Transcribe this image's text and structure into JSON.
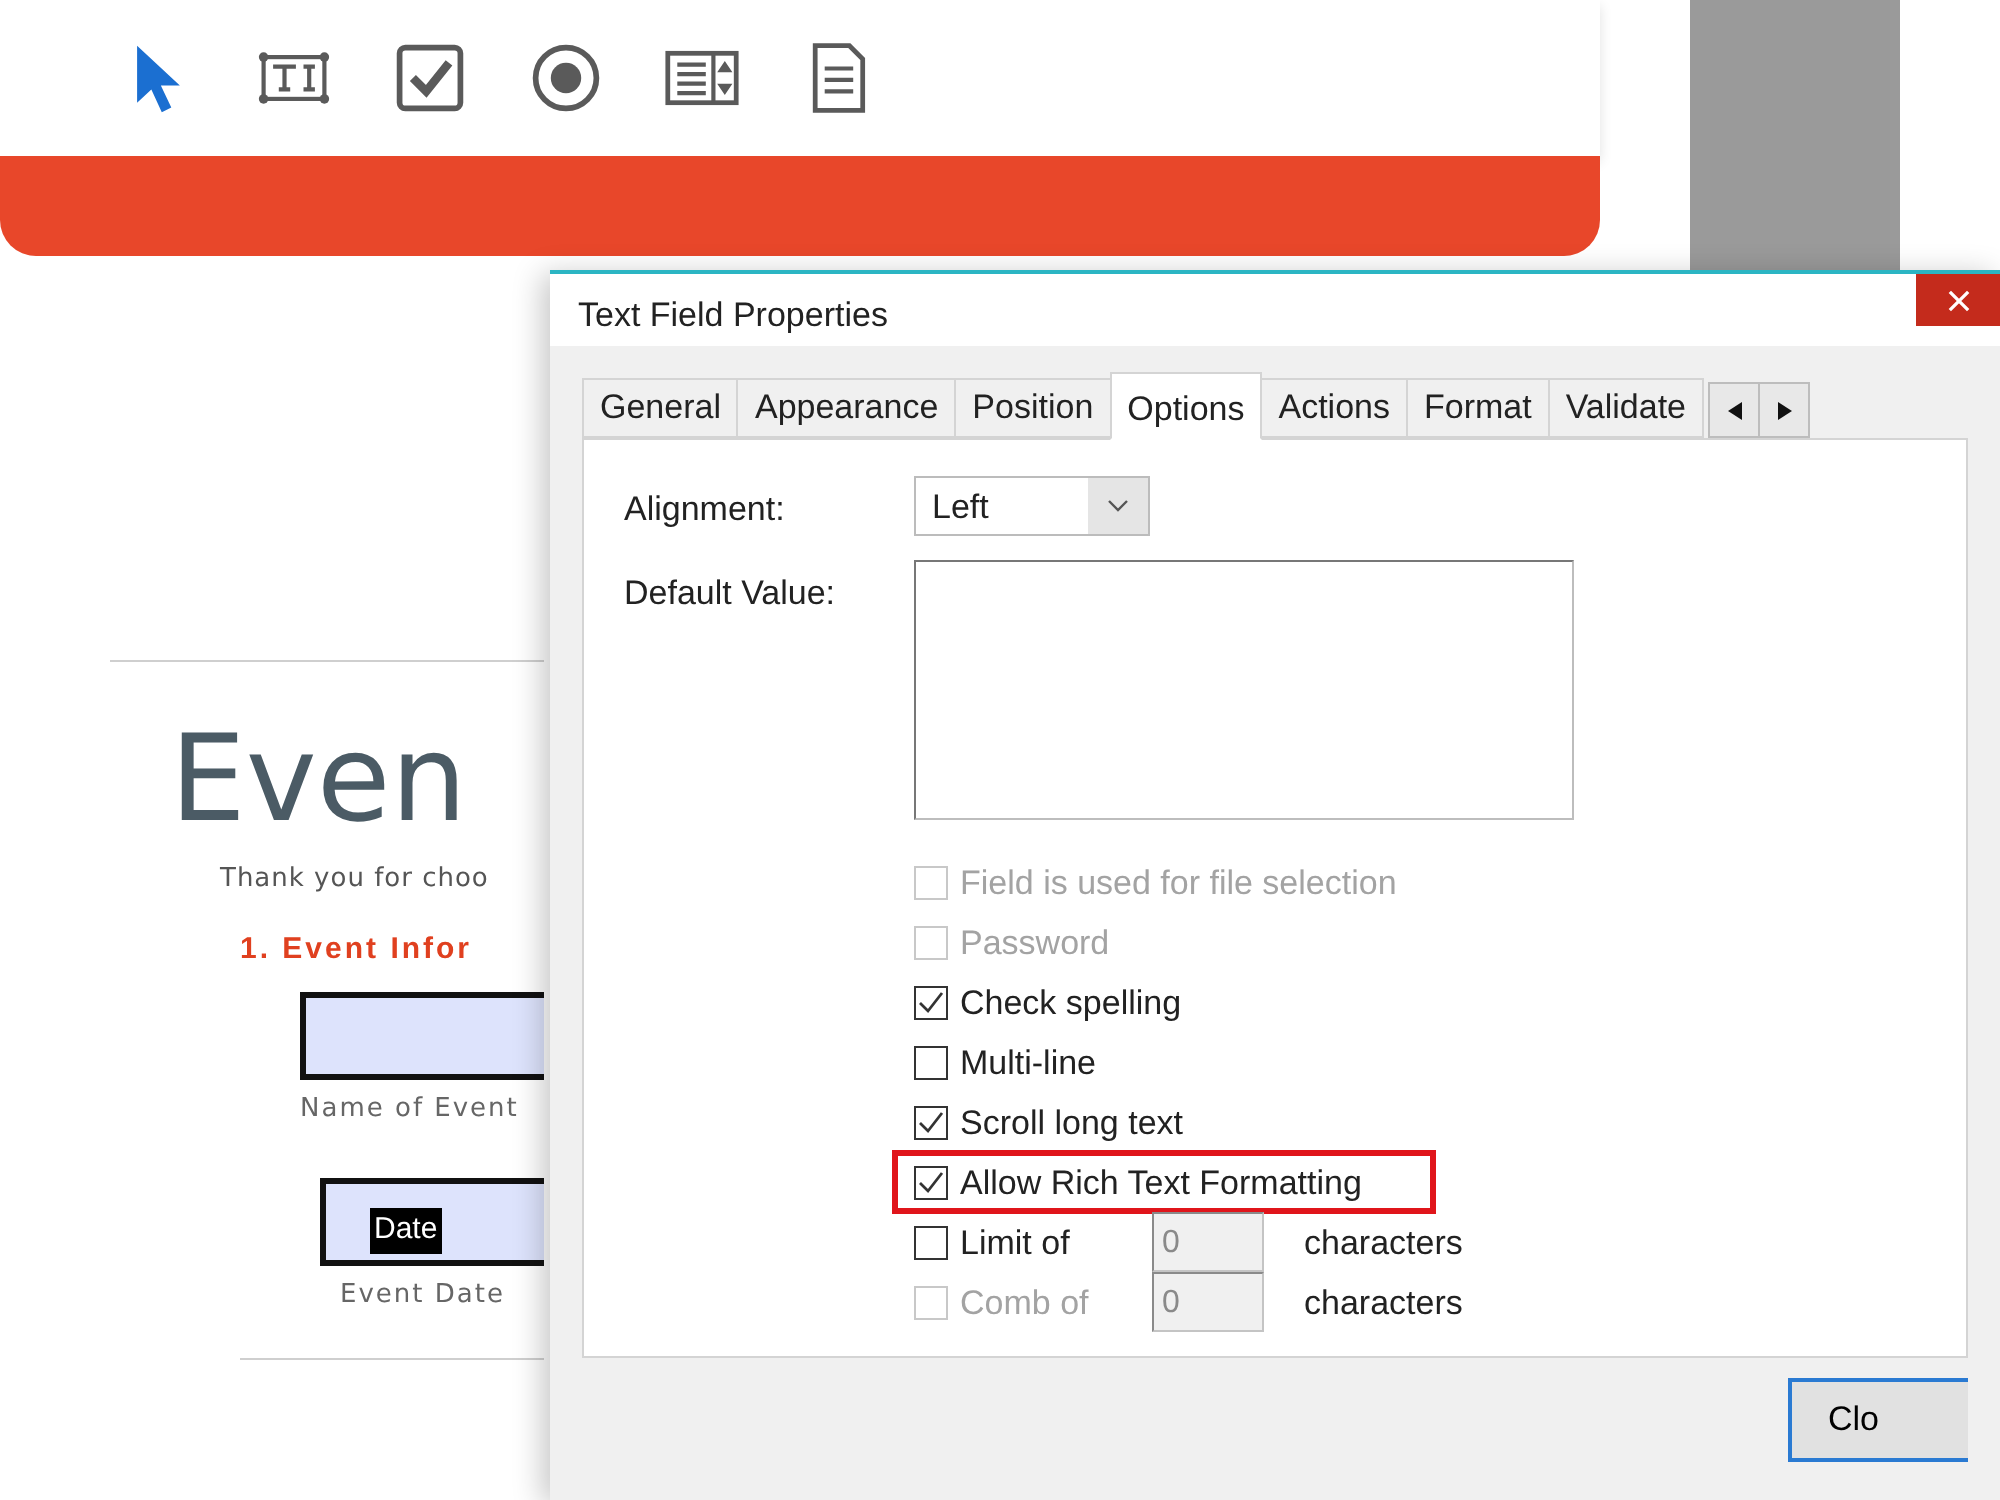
{
  "toolbar": {
    "tools": [
      {
        "kind": "pointer",
        "selected": true
      },
      {
        "kind": "text-field",
        "selected": false
      },
      {
        "kind": "checkbox",
        "selected": false
      },
      {
        "kind": "radio",
        "selected": false
      },
      {
        "kind": "list-box",
        "selected": false
      },
      {
        "kind": "document",
        "selected": false
      }
    ]
  },
  "document": {
    "title": "Even",
    "intro": "Thank you for choo",
    "section": "1. Event Infor",
    "fields": [
      {
        "label": "Name of Event"
      },
      {
        "value": "Date",
        "text_selected": true,
        "label": "Event Date"
      }
    ]
  },
  "dialog": {
    "title": "Text Field Properties",
    "tabs": [
      {
        "label": "General",
        "selected": false
      },
      {
        "label": "Appearance",
        "selected": false
      },
      {
        "label": "Position",
        "selected": false
      },
      {
        "label": "Options",
        "selected": true
      },
      {
        "label": "Actions",
        "selected": false
      },
      {
        "label": "Format",
        "selected": false
      },
      {
        "label": "Validate",
        "selected": false
      }
    ],
    "alignment": {
      "label": "Alignment:",
      "value": "Left"
    },
    "default_value": {
      "label": "Default Value:"
    },
    "options": [
      {
        "kind": "check",
        "label": "Field is used for file selection",
        "checked": false,
        "disabled": true,
        "highlighted": false
      },
      {
        "kind": "check",
        "label": "Password",
        "checked": false,
        "disabled": true,
        "highlighted": false
      },
      {
        "kind": "check",
        "label": "Check spelling",
        "checked": true,
        "disabled": false,
        "highlighted": false
      },
      {
        "kind": "check",
        "label": "Multi-line",
        "checked": false,
        "disabled": false,
        "highlighted": false
      },
      {
        "kind": "check",
        "label": "Scroll long text",
        "checked": true,
        "disabled": false,
        "highlighted": false
      },
      {
        "kind": "check",
        "label": "Allow Rich Text Formatting",
        "checked": true,
        "disabled": false,
        "highlighted": true
      },
      {
        "kind": "count",
        "label": "Limit of",
        "checked": false,
        "disabled": false,
        "highlighted": false,
        "value": "0",
        "unit": "characters"
      },
      {
        "kind": "count",
        "label": "Comb of",
        "checked": false,
        "disabled": true,
        "highlighted": false,
        "value": "0",
        "unit": "characters"
      }
    ],
    "buttons": [
      "Clo"
    ]
  }
}
